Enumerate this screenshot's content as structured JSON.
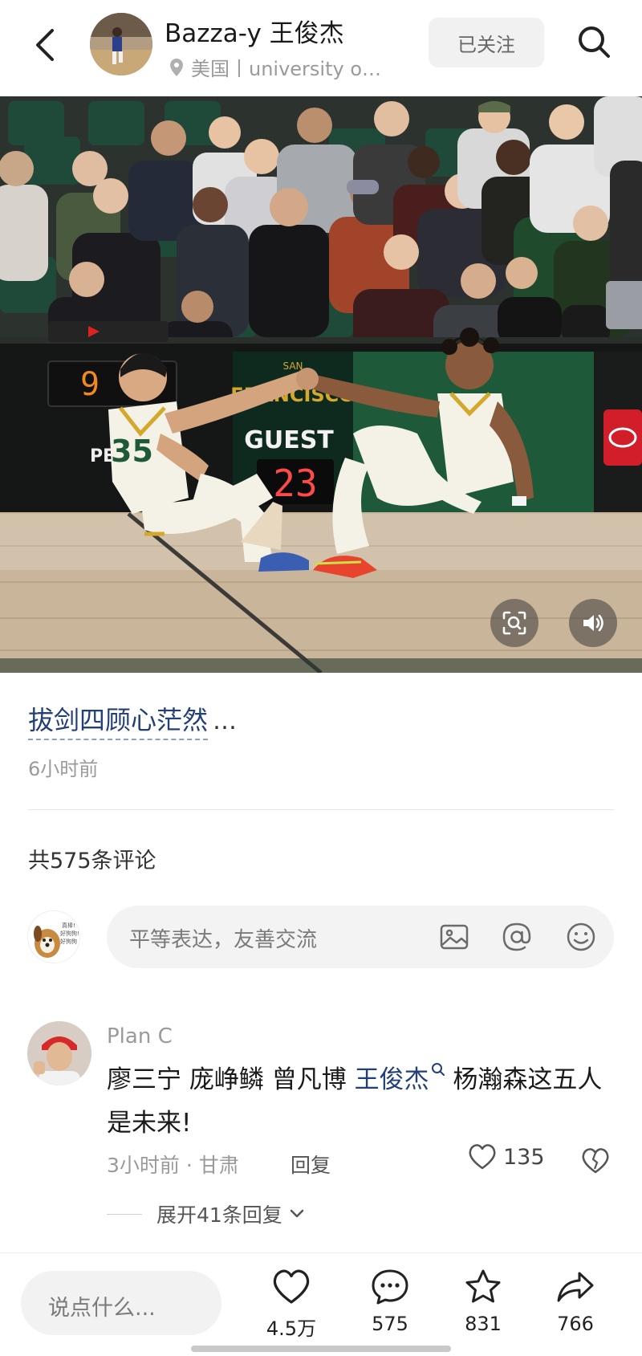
{
  "header": {
    "author_name": "Bazza-y 王俊杰",
    "location": "美国丨university o…",
    "follow_label": "已关注"
  },
  "post": {
    "title": "拔剑四顾心茫然",
    "title_more": "…",
    "time": "6小时前",
    "photo": {
      "scoreboard_guest_label": "GUEST",
      "scoreboard_guest_score": "23",
      "scoreboard_left_digits": "9",
      "banner_text": "SAN FRANCISCO",
      "jersey_number_left": "35"
    }
  },
  "comments_section": {
    "count_label": "共575条评论",
    "input_placeholder": "平等表达，友善交流",
    "my_avatar_text": "真棒! 好狗狗! 好狗狗"
  },
  "comment": {
    "user": "Plan C",
    "text_before": "廖三宁 庞峥鳞 曾凡博 ",
    "mention": "王俊杰",
    "text_after": " 杨瀚森这五人是未来!",
    "meta": "3小时前 · 甘肃",
    "reply_label": "回复",
    "likes": "135",
    "expand_label": "展开41条回复"
  },
  "bottom_bar": {
    "input_placeholder": "说点什么...",
    "likes": "4.5万",
    "comments": "575",
    "favorites": "831",
    "shares": "766"
  },
  "colors": {
    "link_blue": "#233f78",
    "court_green": "#1e5a3a",
    "gold": "#d4a82a"
  }
}
